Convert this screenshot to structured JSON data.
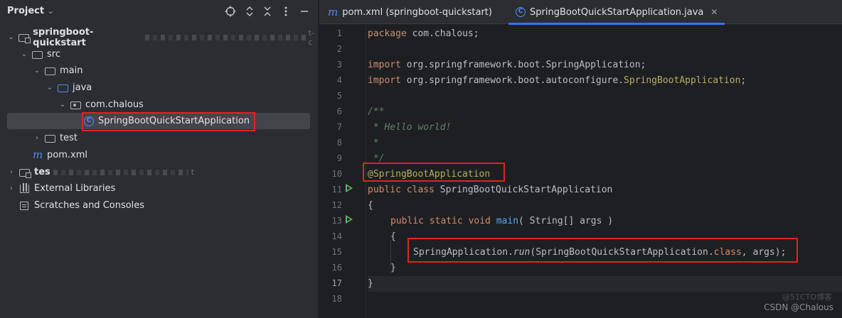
{
  "project": {
    "title": "Project",
    "title_chevron": "⌄",
    "header_icons": [
      "target-icon",
      "expand-collapse-icon",
      "collapse-all-icon",
      "more-icon",
      "minimize-icon"
    ],
    "tree": [
      {
        "label": "springboot-quickstart",
        "suffix_blurred": "t-c",
        "arrow": "⌄",
        "icon": "module-folder-icon"
      },
      {
        "label": "src",
        "arrow": "⌄",
        "icon": "folder-icon"
      },
      {
        "label": "main",
        "arrow": "⌄",
        "icon": "folder-icon"
      },
      {
        "label": "java",
        "arrow": "⌄",
        "icon": "source-folder-icon"
      },
      {
        "label": "com.chalous",
        "arrow": "⌄",
        "icon": "package-icon"
      },
      {
        "label": "SpringBootQuickStartApplication",
        "arrow": "",
        "icon": "class-icon"
      },
      {
        "label": "test",
        "arrow": "›",
        "icon": "folder-icon"
      },
      {
        "label": "pom.xml",
        "arrow": "",
        "icon": "maven-icon"
      },
      {
        "label": "tes",
        "suffix_blurred": "t",
        "arrow": "›",
        "icon": "module-folder-icon"
      },
      {
        "label": "External Libraries",
        "arrow": "›",
        "icon": "libraries-icon"
      },
      {
        "label": "Scratches and Consoles",
        "arrow": "",
        "icon": "scratches-icon"
      }
    ]
  },
  "tabs": [
    {
      "label": "pom.xml (springboot-quickstart)",
      "icon": "m"
    },
    {
      "label": "SpringBootQuickStartApplication.java",
      "icon": "C",
      "close": "✕"
    }
  ],
  "editor": {
    "line_numbers": [
      "1",
      "2",
      "3",
      "4",
      "5",
      "6",
      "7",
      "8",
      "9",
      "10",
      "11",
      "12",
      "13",
      "14",
      "15",
      "16",
      "17",
      "18"
    ],
    "current_line": 17,
    "code": {
      "l1_kw": "package",
      "l1_rest": " com.chalous;",
      "l3_kw": "import",
      "l3_rest": " org.springframework.boot.SpringApplication;",
      "l4_kw": "import",
      "l4_rest": " org.springframework.boot.autoconfigure.",
      "l4_ann": "SpringBootApplication",
      "l4_end": ";",
      "l6": "/**",
      "l7": " * Hello world!",
      "l8": " *",
      "l9": " */",
      "l10": "@SpringBootApplication",
      "l11_kw": "public class",
      "l11_rest": " SpringBootQuickStartApplication",
      "l12": "{",
      "l13_kw": "public static void",
      "l13_fn": "main",
      "l13_rest": "( String[] args )",
      "l14": "{",
      "l15_a": "SpringApplication.",
      "l15_fn": "run",
      "l15_b": "(SpringBootQuickStartApplication.",
      "l15_kw": "class",
      "l15_c": ", args);",
      "l16": "}",
      "l17": "}"
    }
  },
  "watermark": "CSDN @Chalous",
  "watermark_faint": "@51CTO博客"
}
